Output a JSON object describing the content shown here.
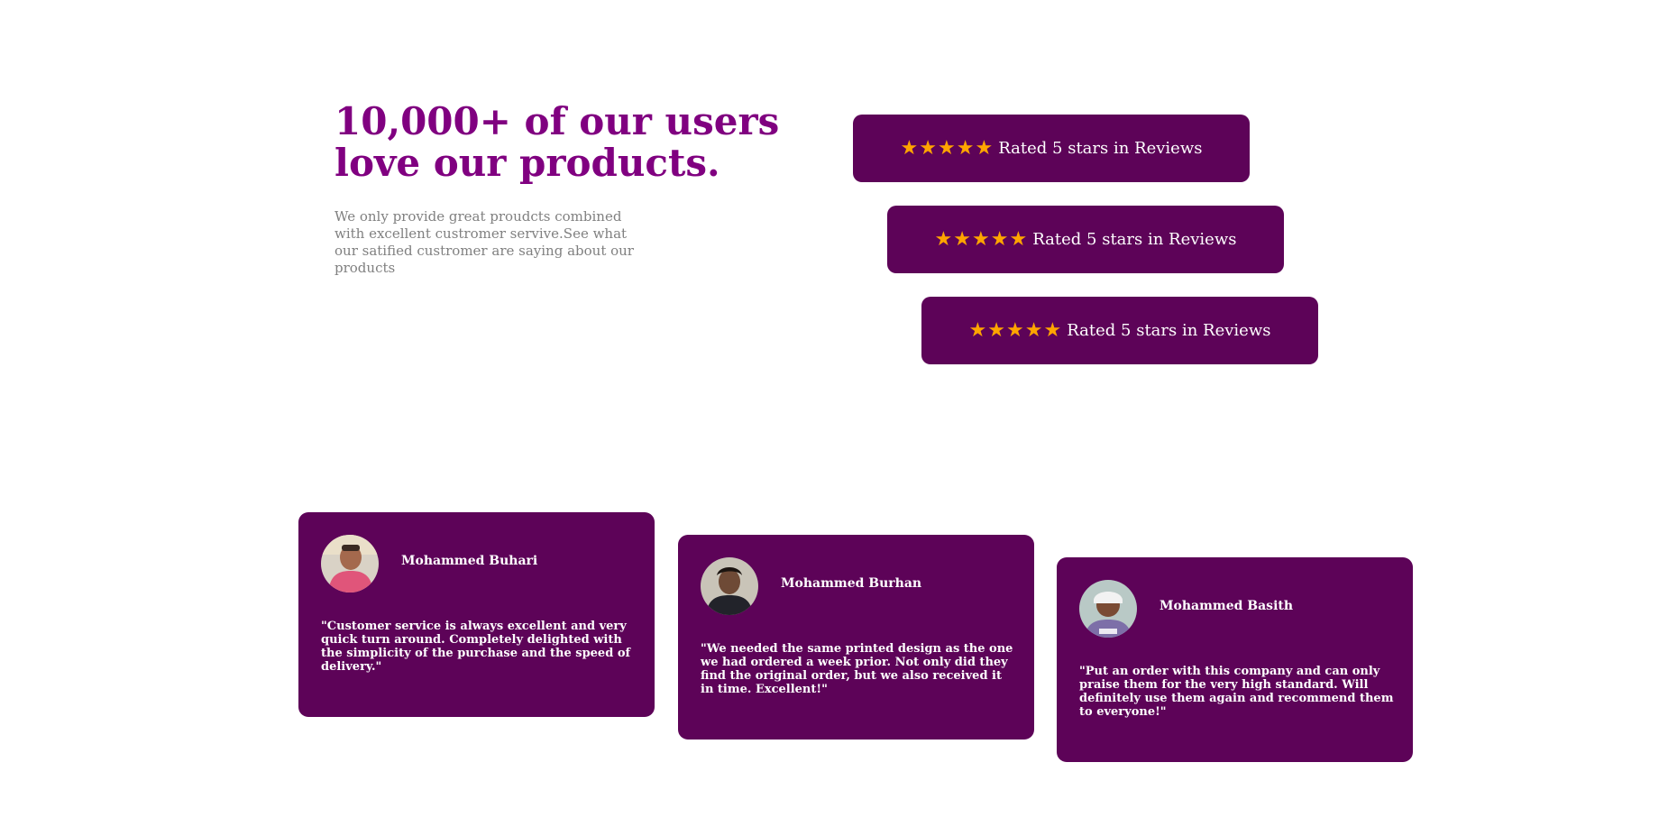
{
  "hero": {
    "headline": "10,000+ of our users love our products.",
    "intro": "We only provide great proudcts combined with excellent custromer servive.See what our satified custromer are saying about our products"
  },
  "ratings": [
    {
      "label": "Rated 5 stars in Reviews",
      "stars": 5
    },
    {
      "label": "Rated 5 stars in Reviews",
      "stars": 5
    },
    {
      "label": "Rated 5 stars in Reviews",
      "stars": 5
    }
  ],
  "testimonials": [
    {
      "name": "Mohammed Buhari",
      "quote": "\"Customer service is always excellent and very quick turn around. Completely delighted with the simplicity of the purchase and the speed of delivery.\""
    },
    {
      "name": "Mohammed Burhan",
      "quote": "\"We needed the same printed design as the one we had ordered a week prior. Not only did they find the original order, but we also received it in time. Excellent!\""
    },
    {
      "name": "Mohammed Basith",
      "quote": "\"Put an order with this company and can only praise them for the very high standard. Will definitely use them again and recommend them to everyone!\""
    }
  ],
  "colors": {
    "accent": "#800080",
    "card": "#5d0358",
    "star": "#ffa500",
    "muted": "#808080"
  },
  "icons": {
    "star": "star-icon",
    "avatar": "avatar"
  }
}
